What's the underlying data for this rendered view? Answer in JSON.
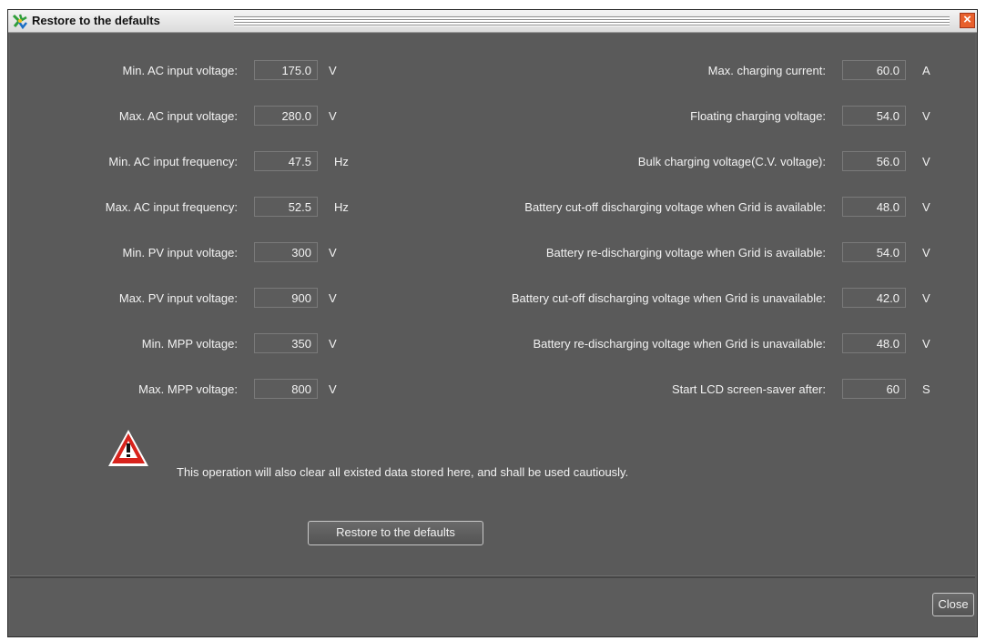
{
  "window": {
    "title": "Restore to the defaults"
  },
  "left_fields": [
    {
      "label": "Min. AC input voltage:",
      "value": "175.0",
      "unit": "V"
    },
    {
      "label": "Max. AC input voltage:",
      "value": "280.0",
      "unit": "V"
    },
    {
      "label": "Min. AC input frequency:",
      "value": "47.5",
      "unit": "Hz"
    },
    {
      "label": "Max. AC input frequency:",
      "value": "52.5",
      "unit": "Hz"
    },
    {
      "label": "Min. PV input voltage:",
      "value": "300",
      "unit": "V"
    },
    {
      "label": "Max. PV input voltage:",
      "value": "900",
      "unit": "V"
    },
    {
      "label": "Min. MPP voltage:",
      "value": "350",
      "unit": "V"
    },
    {
      "label": "Max. MPP voltage:",
      "value": "800",
      "unit": "V"
    }
  ],
  "right_fields": [
    {
      "label": "Max. charging current:",
      "value": "60.0",
      "unit": "A"
    },
    {
      "label": "Floating charging voltage:",
      "value": "54.0",
      "unit": "V"
    },
    {
      "label": "Bulk charging voltage(C.V. voltage):",
      "value": "56.0",
      "unit": "V"
    },
    {
      "label": "Battery cut-off discharging voltage when Grid is available:",
      "value": "48.0",
      "unit": "V"
    },
    {
      "label": "Battery re-discharging voltage when Grid is available:",
      "value": "54.0",
      "unit": "V"
    },
    {
      "label": "Battery cut-off discharging voltage when Grid is unavailable:",
      "value": "42.0",
      "unit": "V"
    },
    {
      "label": "Battery re-discharging voltage when Grid is unavailable:",
      "value": "48.0",
      "unit": "V"
    },
    {
      "label": "Start LCD screen-saver after:",
      "value": "60",
      "unit": "S"
    }
  ],
  "warning": {
    "icon": "warning-triangle-icon",
    "text": "This operation will also clear all existed data stored here, and shall be used cautiously."
  },
  "buttons": {
    "restore_label": "Restore to the defaults",
    "close_label": "Close"
  },
  "colors": {
    "background": "#5a5a5a",
    "warning_red": "#d8231c",
    "title_close": "#e8602c"
  }
}
